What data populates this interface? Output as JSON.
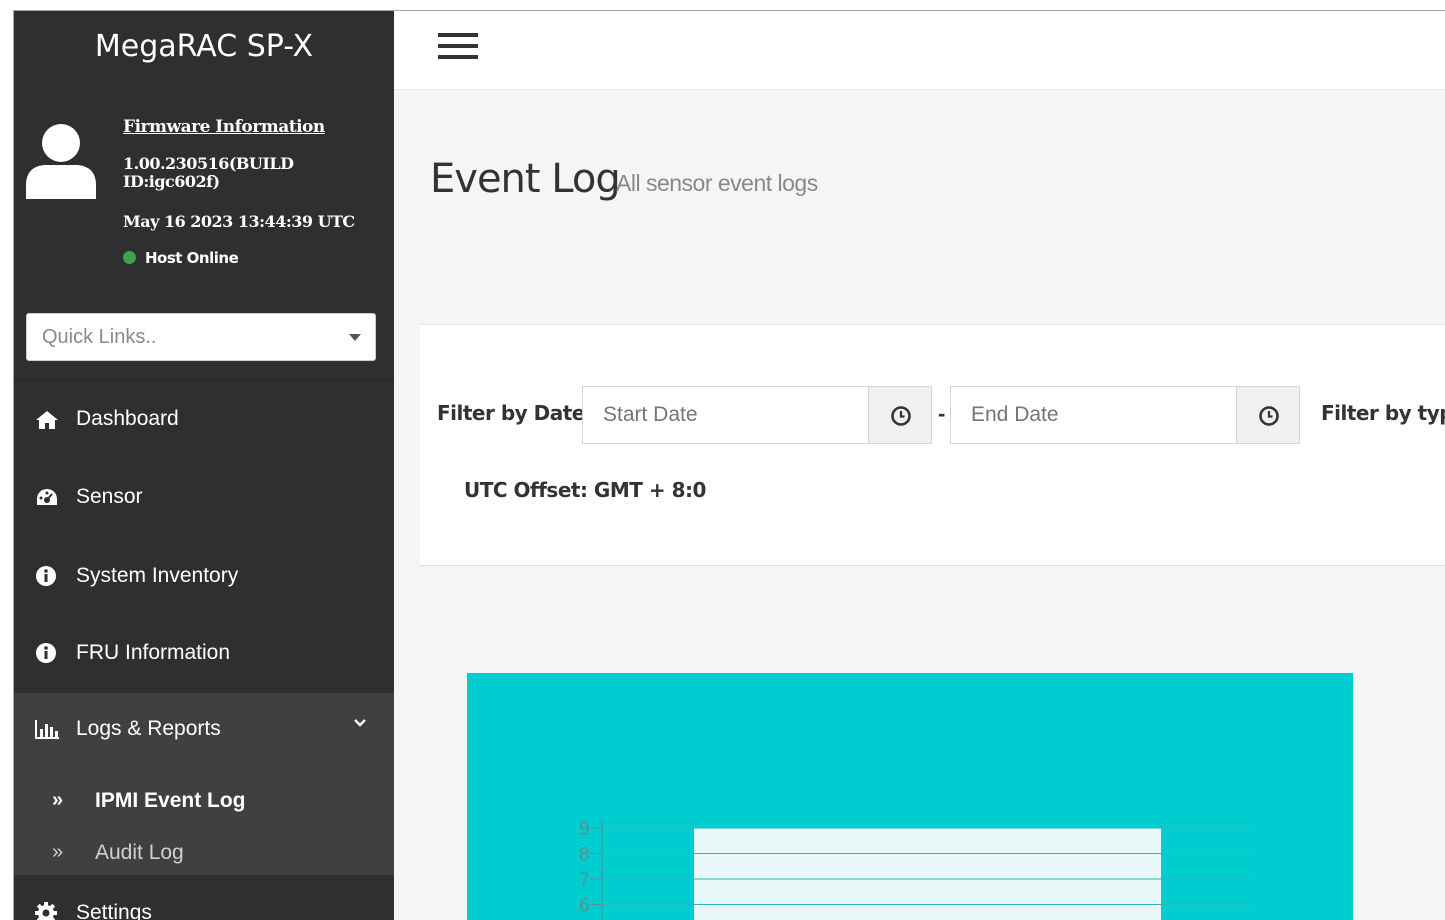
{
  "sidebar": {
    "brand": "MegaRAC SP-X",
    "firmware": {
      "link_label": "Firmware Information",
      "version": "1.00.230516(BUILD ID:igc602f)",
      "date": "May 16 2023 13:44:39 UTC",
      "host_status": "Host Online",
      "host_status_color": "#3fa34d"
    },
    "quick_links_placeholder": "Quick Links..",
    "nav": [
      {
        "label": "Dashboard",
        "icon": "home-icon"
      },
      {
        "label": "Sensor",
        "icon": "gauge-icon"
      },
      {
        "label": "System Inventory",
        "icon": "info-icon"
      },
      {
        "label": "FRU Information",
        "icon": "info-icon"
      },
      {
        "label": "Logs & Reports",
        "icon": "bar-chart-icon"
      },
      {
        "label": "Settings",
        "icon": "gear-icon"
      }
    ],
    "submenu": [
      {
        "label": "IPMI Event Log",
        "marker": "»"
      },
      {
        "label": "Audit Log",
        "marker": "»"
      }
    ]
  },
  "header": {
    "menu_icon": "hamburger-icon"
  },
  "page": {
    "title": "Event Log",
    "subtitle": "All sensor event logs"
  },
  "filters": {
    "date_label": "Filter by Date",
    "start_placeholder": "Start Date",
    "end_placeholder": "End Date",
    "separator": "-",
    "type_label": "Filter by typ",
    "utc_offset": "UTC Offset: GMT + 8:0"
  },
  "chart_data": {
    "type": "bar",
    "y_ticks": [
      "9",
      "8",
      "7",
      "6"
    ],
    "background": "#00cdd0",
    "bar_color": "#e6f8f8"
  }
}
